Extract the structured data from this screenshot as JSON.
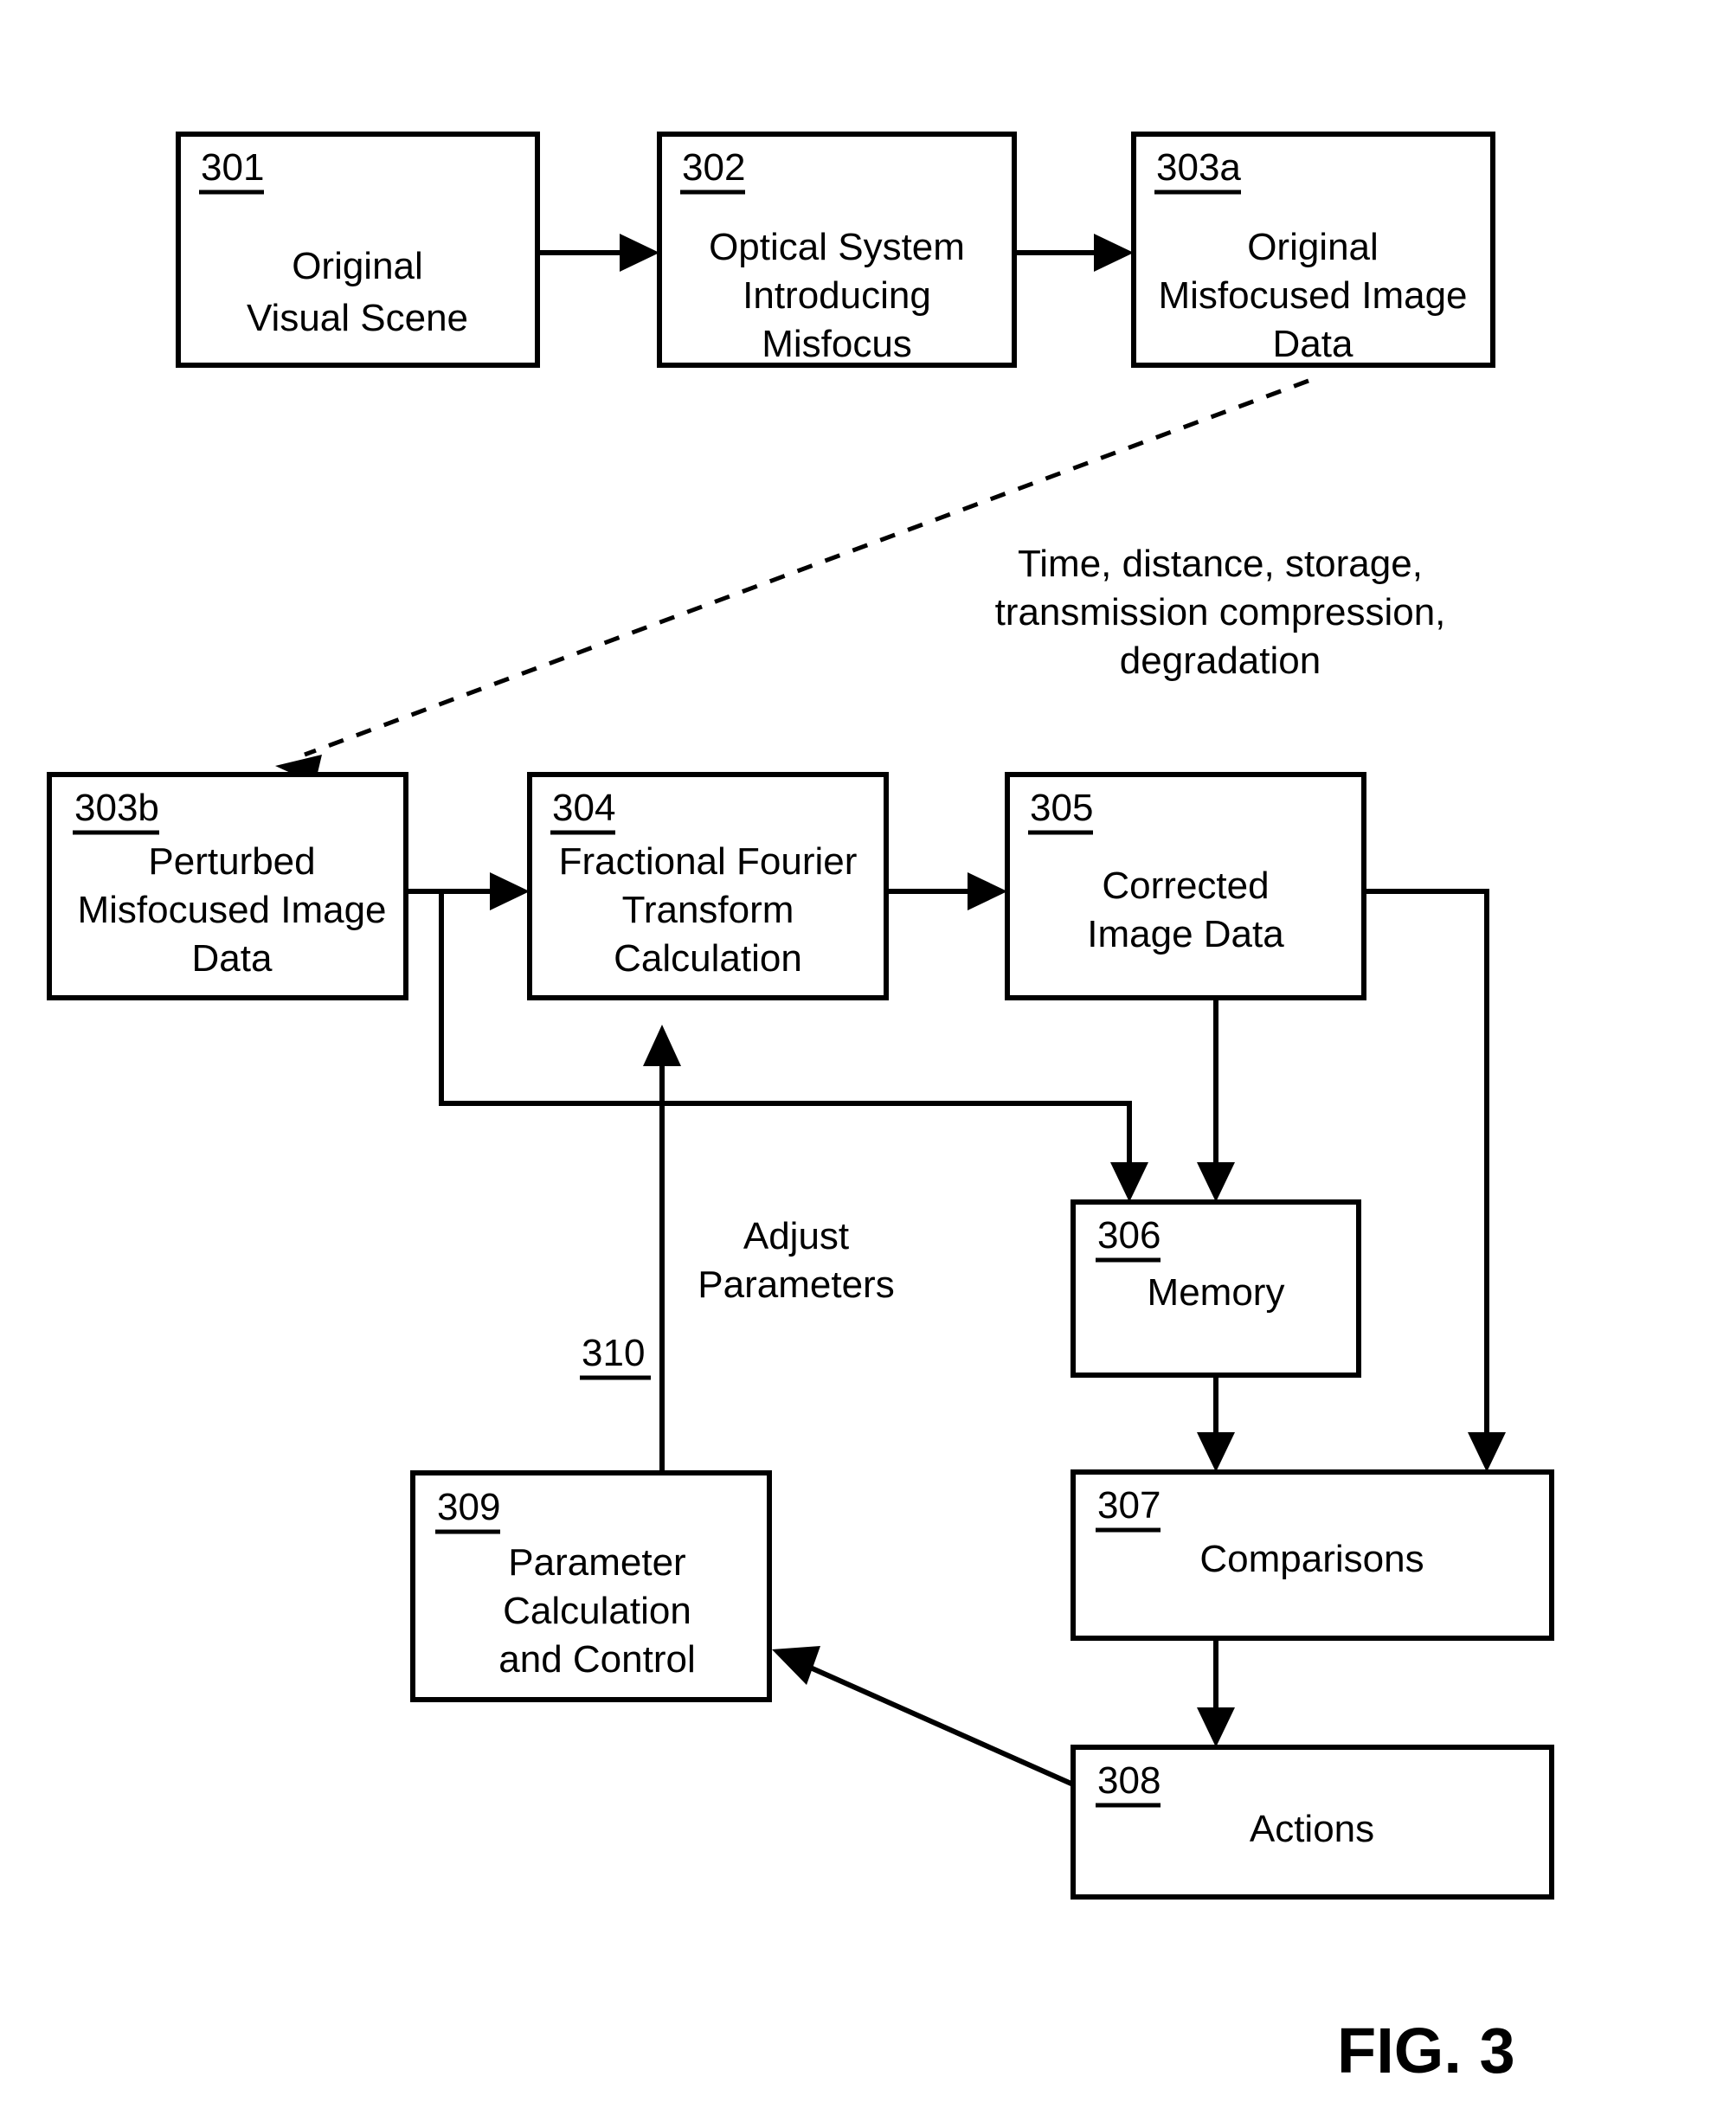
{
  "figure": {
    "caption": "FIG. 3",
    "boxes": [
      {
        "id": "301",
        "ref": "301",
        "lines": [
          "Original",
          "Visual Scene"
        ]
      },
      {
        "id": "302",
        "ref": "302",
        "lines": [
          "Optical System",
          "Introducing",
          "Misfocus"
        ]
      },
      {
        "id": "303a",
        "ref": "303a",
        "lines": [
          "Original",
          "Misfocused Image",
          "Data"
        ]
      },
      {
        "id": "303b",
        "ref": "303b",
        "lines": [
          "Perturbed",
          "Misfocused Image",
          "Data"
        ]
      },
      {
        "id": "304",
        "ref": "304",
        "lines": [
          "Fractional Fourier",
          "Transform",
          "Calculation"
        ]
      },
      {
        "id": "305",
        "ref": "305",
        "lines": [
          "Corrected",
          "Image Data"
        ]
      },
      {
        "id": "306",
        "ref": "306",
        "lines": [
          "Memory"
        ]
      },
      {
        "id": "307",
        "ref": "307",
        "lines": [
          "Comparisons"
        ]
      },
      {
        "id": "308",
        "ref": "308",
        "lines": [
          "Actions"
        ]
      },
      {
        "id": "309",
        "ref": "309",
        "lines": [
          "Parameter",
          "Calculation",
          "and Control"
        ]
      }
    ],
    "annotations": [
      {
        "id": "degradation-note",
        "lines": [
          "Time, distance, storage,",
          "transmission compression,",
          "degradation"
        ]
      },
      {
        "id": "adjust-parameters-note",
        "lines": [
          "Adjust",
          "Parameters"
        ]
      }
    ],
    "edge_refs": [
      {
        "id": "310",
        "ref": "310"
      }
    ],
    "colors": {
      "stroke": "#000000",
      "fill": "#ffffff",
      "text": "#000000"
    }
  }
}
